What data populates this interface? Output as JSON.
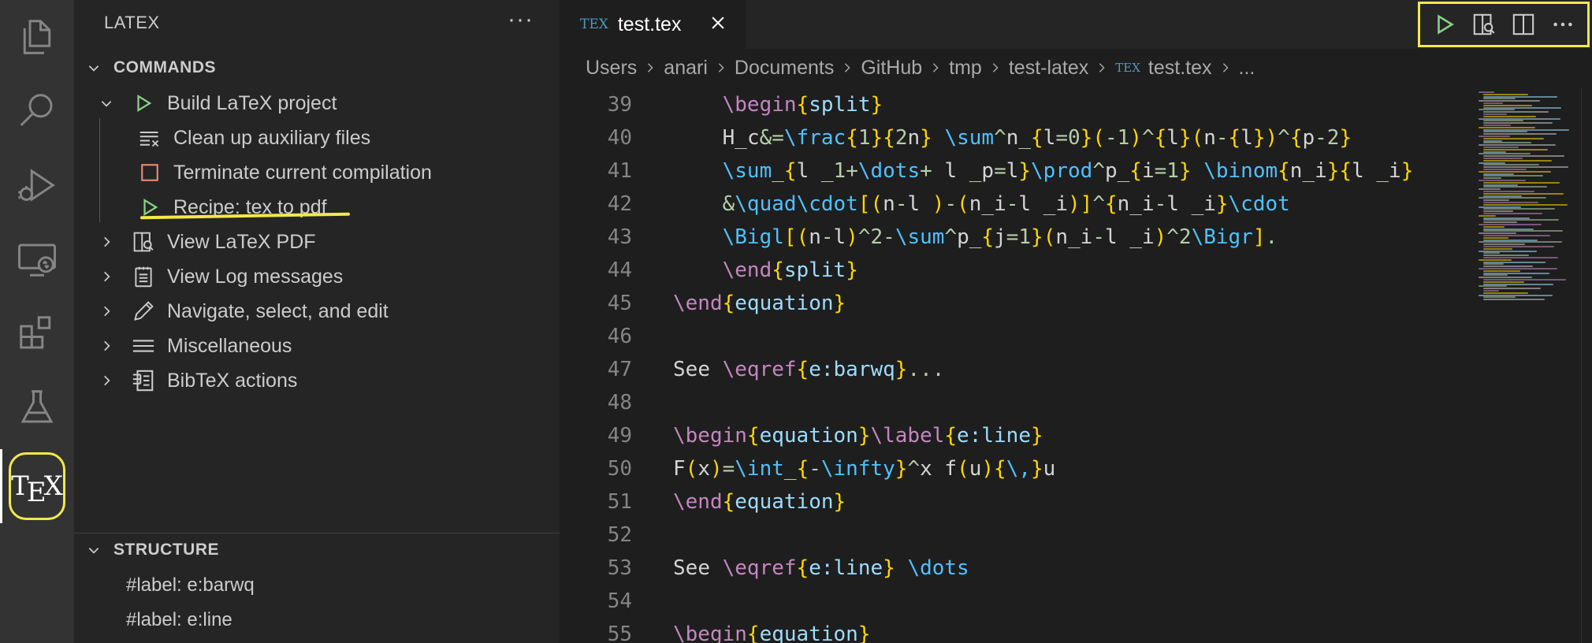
{
  "sidebar": {
    "title": "LATEX",
    "more_label": "···",
    "commands": {
      "header": "COMMANDS",
      "items": [
        {
          "label": "Build LaTeX project",
          "icon": "play-icon",
          "expanded": true
        },
        {
          "label": "Clean up auxiliary files",
          "icon": "clear-all-icon"
        },
        {
          "label": "Terminate current compilation",
          "icon": "stop-icon"
        },
        {
          "label": "Recipe: tex to pdf",
          "icon": "play-icon"
        },
        {
          "label": "View LaTeX PDF",
          "icon": "open-preview-icon"
        },
        {
          "label": "View Log messages",
          "icon": "output-icon"
        },
        {
          "label": "Navigate, select, and edit",
          "icon": "edit-icon"
        },
        {
          "label": "Miscellaneous",
          "icon": "menu-lines-icon"
        },
        {
          "label": "BibTeX actions",
          "icon": "references-icon"
        }
      ]
    },
    "structure": {
      "header": "STRUCTURE",
      "items": [
        "#label: e:barwq",
        "#label: e:line"
      ]
    }
  },
  "activity_bar": {
    "items": [
      "explorer",
      "search",
      "run-and-debug",
      "remote-explorer",
      "extensions",
      "testing",
      "tex"
    ],
    "tex_label": "TEX"
  },
  "editor": {
    "tab": {
      "icon_text": "TEX",
      "name": "test.tex"
    },
    "breadcrumbs": [
      "Users",
      "anari",
      "Documents",
      "GitHub",
      "tmp",
      "test-latex",
      "test.tex",
      "..."
    ],
    "lines": [
      {
        "n": "39"
      },
      {
        "n": "40"
      },
      {
        "n": "41"
      },
      {
        "n": "42"
      },
      {
        "n": "43"
      },
      {
        "n": "44"
      },
      {
        "n": "45"
      },
      {
        "n": "46"
      },
      {
        "n": "47"
      },
      {
        "n": "48"
      },
      {
        "n": "49"
      },
      {
        "n": "50"
      },
      {
        "n": "51"
      },
      {
        "n": "52"
      },
      {
        "n": "53"
      },
      {
        "n": "54"
      },
      {
        "n": "55"
      }
    ],
    "code_text": [
      "    \\begin{split}",
      "    H_c&=\\frac{1}{2n} \\sum^n_{l=0}(-1)^{l}(n-{l})^{p-2}",
      "    \\sum_{l _1+\\dots+ l _p=l}\\prod^p_{i=1} \\binom{n_i}{l _i}",
      "    &\\quad\\cdot[(n-l )-(n_i-l _i)]^{n_i-l _i}\\cdot",
      "    \\Bigl[(n-l)^2-\\sum^p_{j=1}(n_i-l _i)^2\\Bigr].",
      "    \\end{split}",
      "\\end{equation}",
      "",
      "See \\eqref{e:barwq}...",
      "",
      "\\begin{equation}\\label{e:line}",
      "F(x)=\\int_{-\\infty}^x f(u){\\,}u",
      "\\end{equation}",
      "",
      "See \\eqref{e:line} \\dots",
      "",
      "\\begin{equation}"
    ]
  },
  "colors": {
    "highlight": "#f3e84a",
    "play_green": "#89d185",
    "stop_red": "#f48771",
    "tex_blue": "#519aba"
  }
}
